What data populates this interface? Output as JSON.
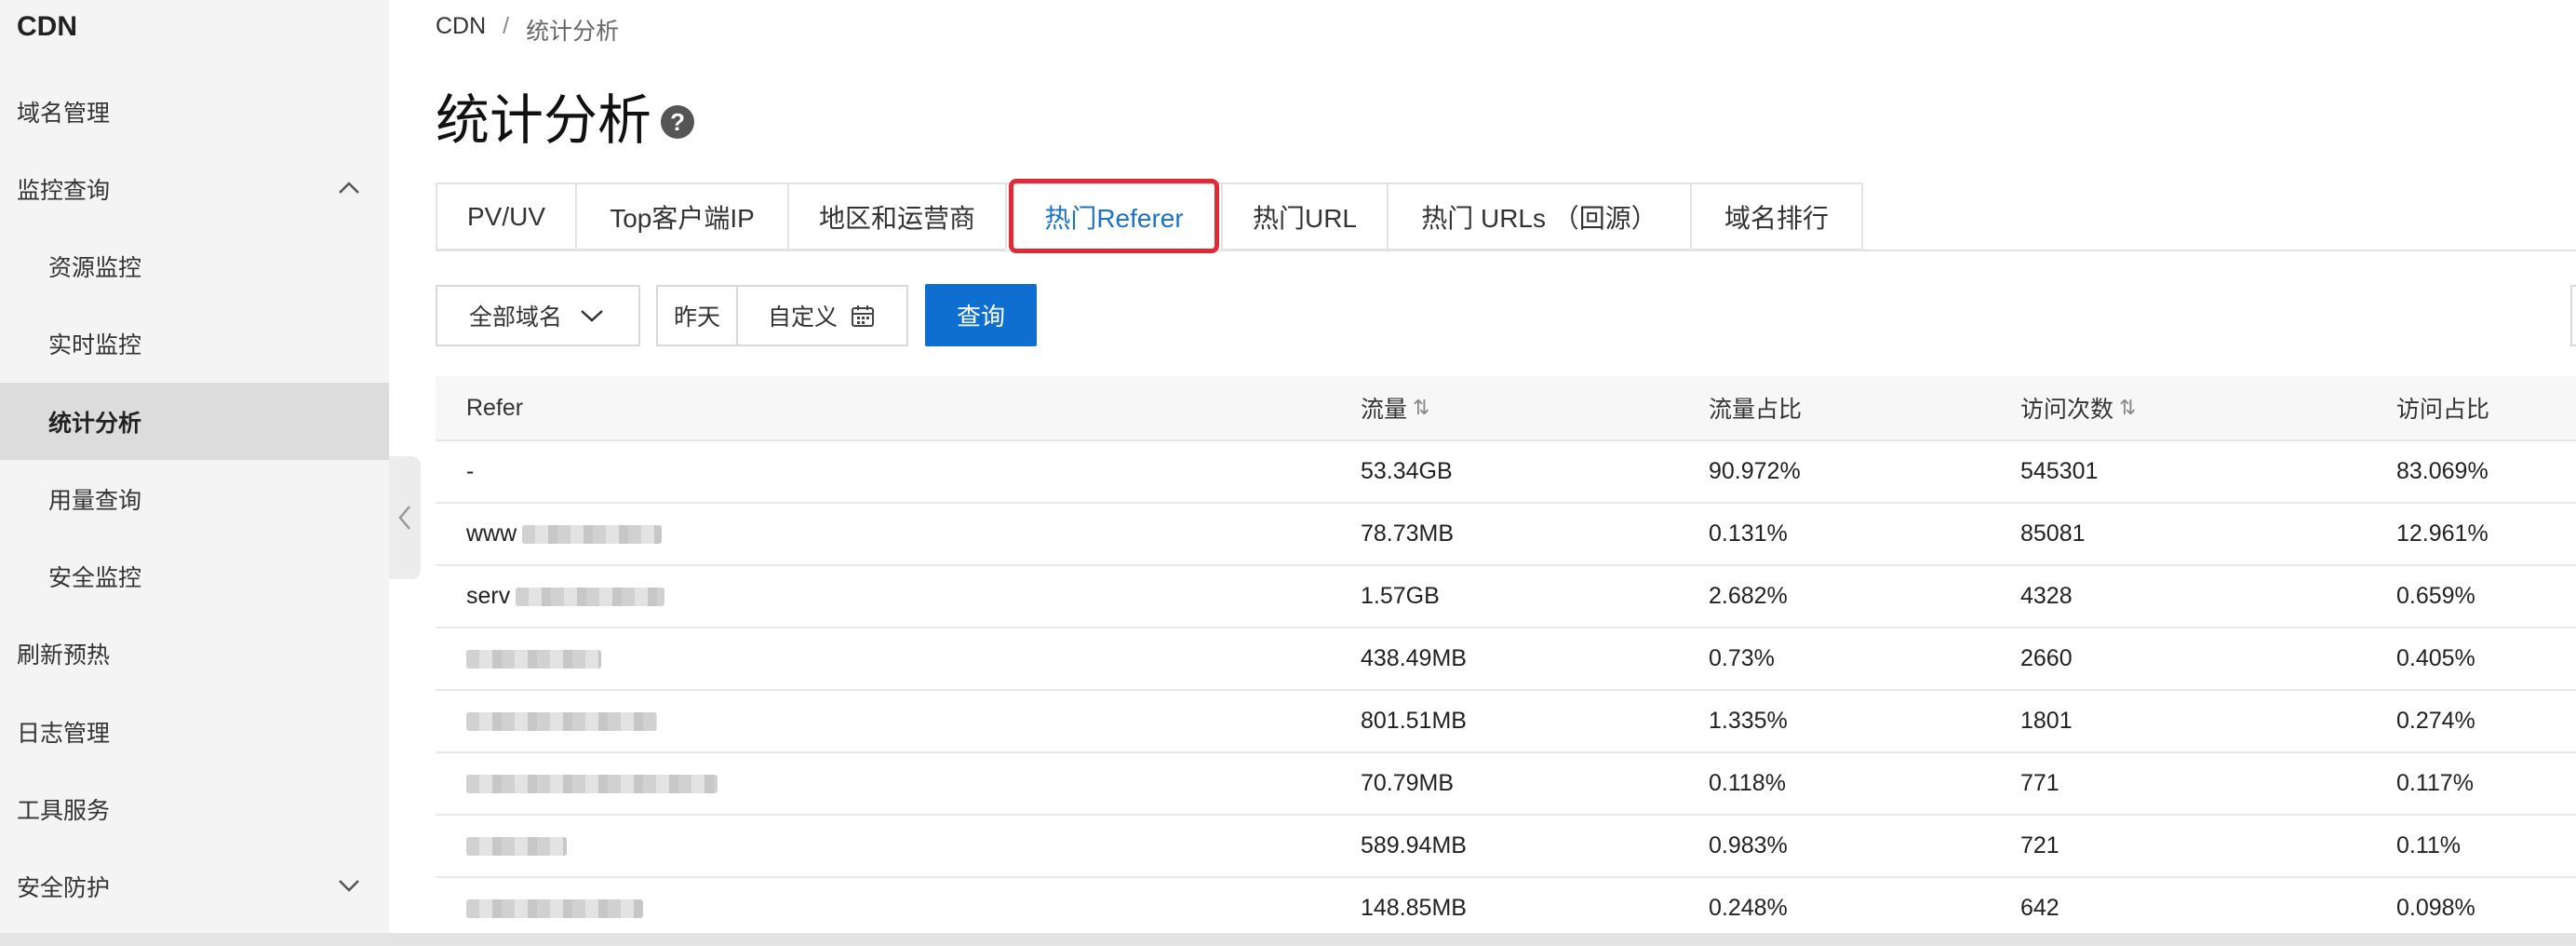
{
  "sidebar": {
    "brand": "CDN",
    "items": [
      {
        "label": "域名管理"
      },
      {
        "label": "监控查询",
        "expanded": true
      },
      {
        "label": "资源监控"
      },
      {
        "label": "实时监控"
      },
      {
        "label": "统计分析",
        "active": true
      },
      {
        "label": "用量查询"
      },
      {
        "label": "安全监控"
      },
      {
        "label": "刷新预热"
      },
      {
        "label": "日志管理"
      },
      {
        "label": "工具服务"
      },
      {
        "label": "安全防护",
        "expanded": false
      }
    ]
  },
  "breadcrumb": {
    "root": "CDN",
    "separator": "/",
    "current": "统计分析"
  },
  "page": {
    "title": "统计分析",
    "help_glyph": "?"
  },
  "tabs": [
    {
      "label": "PV/UV"
    },
    {
      "label": "Top客户端IP"
    },
    {
      "label": "地区和运营商"
    },
    {
      "label": "热门Referer",
      "active": true
    },
    {
      "label": "热门URL"
    },
    {
      "label": "热门 URLs （回源）"
    },
    {
      "label": "域名排行"
    }
  ],
  "filters": {
    "domain_select": "全部域名",
    "date_yesterday": "昨天",
    "date_custom": "自定义",
    "query_button": "查询"
  },
  "table": {
    "columns": [
      "Refer",
      "流量",
      "流量占比",
      "访问次数",
      "访问占比"
    ],
    "rows": [
      {
        "refer": "-",
        "traffic": "53.34GB",
        "traffic_pct": "90.972%",
        "visits": "545301",
        "visit_pct": "83.069%"
      },
      {
        "refer": "www",
        "traffic": "78.73MB",
        "traffic_pct": "0.131%",
        "visits": "85081",
        "visit_pct": "12.961%"
      },
      {
        "refer": "serv",
        "traffic": "1.57GB",
        "traffic_pct": "2.682%",
        "visits": "4328",
        "visit_pct": "0.659%"
      },
      {
        "refer": "",
        "traffic": "438.49MB",
        "traffic_pct": "0.73%",
        "visits": "2660",
        "visit_pct": "0.405%"
      },
      {
        "refer": "",
        "traffic": "801.51MB",
        "traffic_pct": "1.335%",
        "visits": "1801",
        "visit_pct": "0.274%"
      },
      {
        "refer": "",
        "traffic": "70.79MB",
        "traffic_pct": "0.118%",
        "visits": "771",
        "visit_pct": "0.117%"
      },
      {
        "refer": "",
        "traffic": "589.94MB",
        "traffic_pct": "0.983%",
        "visits": "721",
        "visit_pct": "0.11%"
      },
      {
        "refer": "",
        "traffic": "148.85MB",
        "traffic_pct": "0.248%",
        "visits": "642",
        "visit_pct": "0.098%"
      }
    ]
  },
  "colors": {
    "accent": "#0f6fd1",
    "active_tab_text": "#1b72c7",
    "highlight": "#e22a36"
  }
}
